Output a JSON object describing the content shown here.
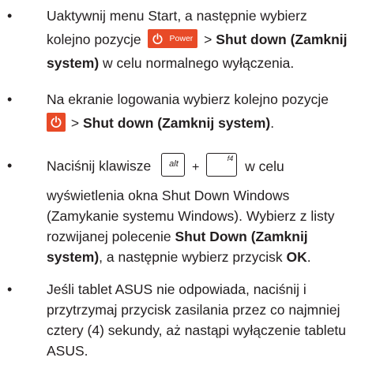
{
  "bullets": [
    {
      "lines": [
        {
          "t1": "Uaktywnij menu Start, a następnie wybierz"
        },
        {
          "t1": "kolejno pozycje",
          "power_label": "Power",
          "t2": ">",
          "b1": "Shut down (Zamknij"
        },
        {
          "b1": "system)",
          "t1": "w celu normalnego wyłączenia."
        }
      ]
    },
    {
      "lines": [
        {
          "t1": "Na ekranie logowania wybierz kolejno pozycje"
        },
        {
          "t1": ">",
          "b1": "Shut down (Zamknij system)",
          "t2": "."
        }
      ]
    },
    {
      "lines": [
        {
          "t1": "Naciśnij klawisze",
          "key1": "alt",
          "plus": "+",
          "key2": "f4",
          "t2": "w celu"
        },
        {
          "t1": "wyświetlenia okna Shut Down Windows"
        },
        {
          "t1": "(Zamykanie systemu Windows). Wybierz z listy"
        },
        {
          "t1": "rozwijanej polecenie",
          "b1": "Shut Down (Zamknij"
        },
        {
          "b1": "system)",
          "t1": ", a następnie wybierz przycisk",
          "b2": "OK",
          "t2": "."
        }
      ]
    },
    {
      "lines": [
        {
          "t1": "Jeśli tablet ASUS nie odpowiada, naciśnij i"
        },
        {
          "t1": "przytrzymaj przycisk zasilania przez co najmniej"
        },
        {
          "t1": "cztery (4) sekundy, aż nastąpi wyłączenie tabletu"
        },
        {
          "t1": "ASUS."
        }
      ]
    }
  ],
  "bullet_char": "•",
  "colors": {
    "text": "#231f20",
    "power_accent": "#e84a27"
  },
  "icons": [
    "power-icon"
  ]
}
